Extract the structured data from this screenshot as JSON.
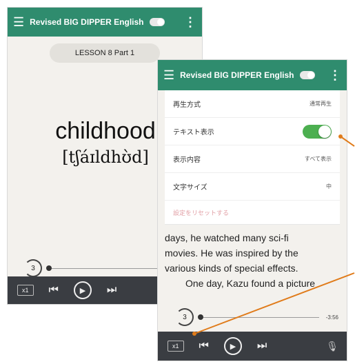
{
  "back_screen": {
    "app_title": "Revised BIG DIPPER English",
    "lesson_label": "LESSON 8 Part 1",
    "word": "childhood",
    "pronunciation": "[tʃáɪldhʊ̀d]",
    "rewind_label": "3",
    "speed_label": "x1"
  },
  "front_screen": {
    "app_title": "Revised BIG DIPPER English",
    "settings": [
      {
        "label": "再生方式",
        "value": "通常再生"
      },
      {
        "label": "テキスト表示",
        "value": ""
      },
      {
        "label": "表示内容",
        "value": "すべて表示"
      },
      {
        "label": "文字サイズ",
        "value": "中"
      }
    ],
    "reset_label": "設定をリセットする",
    "story_lines": [
      "days, he watched many sci-fi",
      "movies.   He was inspired by the",
      "various kinds of special effects.",
      "One day, Kazu found a picture"
    ],
    "rewind_label": "3",
    "time": "-3:56",
    "speed_label": "x1"
  },
  "colors": {
    "app_bar": "#2f8c6e",
    "control_bar": "#3a3d42",
    "toggle_on": "#4caf50",
    "callout_line": "#e07b1a"
  }
}
